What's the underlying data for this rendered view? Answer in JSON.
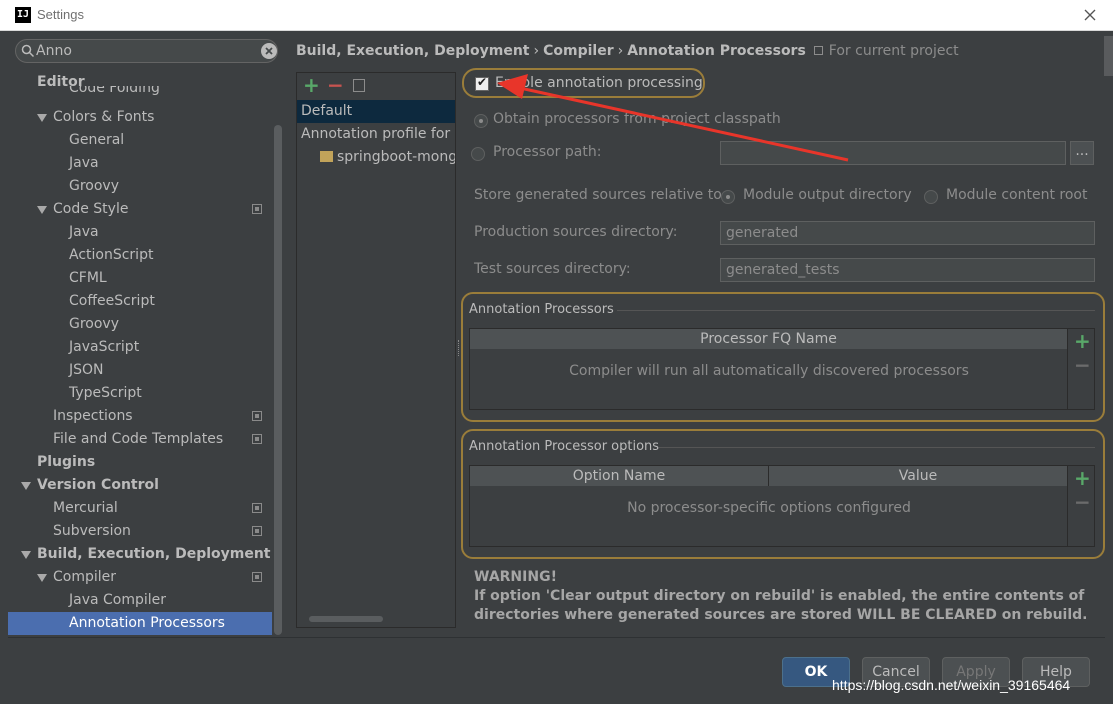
{
  "window": {
    "title": "Settings",
    "app_icon_text": "IJ"
  },
  "search": {
    "value": "Anno"
  },
  "sidebar": {
    "items": [
      {
        "label": "Editor",
        "bold": true
      },
      {
        "label": "Code Folding"
      },
      {
        "label": "Colors & Fonts",
        "expanded": true
      },
      {
        "label": "General"
      },
      {
        "label": "Java"
      },
      {
        "label": "Groovy"
      },
      {
        "label": "Code Style",
        "expanded": true
      },
      {
        "label": "Java"
      },
      {
        "label": "ActionScript"
      },
      {
        "label": "CFML"
      },
      {
        "label": "CoffeeScript"
      },
      {
        "label": "Groovy"
      },
      {
        "label": "JavaScript"
      },
      {
        "label": "JSON"
      },
      {
        "label": "TypeScript"
      },
      {
        "label": "Inspections"
      },
      {
        "label": "File and Code Templates"
      },
      {
        "label": "Plugins",
        "bold": true
      },
      {
        "label": "Version Control",
        "bold": true,
        "expanded": true
      },
      {
        "label": "Mercurial"
      },
      {
        "label": "Subversion"
      },
      {
        "label": "Build, Execution, Deployment",
        "bold": true,
        "expanded": true
      },
      {
        "label": "Compiler",
        "expanded": true
      },
      {
        "label": "Java Compiler"
      },
      {
        "label": "Annotation Processors",
        "selected": true
      }
    ]
  },
  "breadcrumb": {
    "parts": [
      "Build, Execution, Deployment",
      "Compiler",
      "Annotation Processors"
    ],
    "separator": "›",
    "scope_note": "For current project"
  },
  "profiles": {
    "items": [
      "Default",
      "Annotation profile for s",
      "springboot-mong"
    ]
  },
  "settings": {
    "enable_label": "Enable annotation processing",
    "enabled": true,
    "obtain_label": "Obtain processors from project classpath",
    "processor_path_label": "Processor path:",
    "processor_path_value": "",
    "browse_label": "...",
    "store_label": "Store generated sources relative to:",
    "module_output_label": "Module output directory",
    "module_content_label": "Module content root",
    "prod_dir_label": "Production sources directory:",
    "prod_dir_value": "generated",
    "test_dir_label": "Test sources directory:",
    "test_dir_value": "generated_tests"
  },
  "processors_group": {
    "title": "Annotation Processors",
    "column": "Processor FQ Name",
    "empty_text": "Compiler will run all automatically discovered processors"
  },
  "options_group": {
    "title": "Annotation Processor options",
    "columns": [
      "Option Name",
      "Value"
    ],
    "empty_text": "No processor-specific options configured"
  },
  "warning": {
    "title": "WARNING!",
    "text": "If option 'Clear output directory on rebuild' is enabled, the entire contents of directories where generated sources are stored WILL BE CLEARED on rebuild."
  },
  "buttons": {
    "ok": "OK",
    "cancel": "Cancel",
    "apply": "Apply",
    "help": "Help"
  },
  "watermark": "https://blog.csdn.net/weixin_39165464",
  "colors": {
    "accent": "#4b6eaf",
    "highlight": "#9a7d3a",
    "arrow": "#e8352a",
    "add": "#59a869",
    "remove": "#c75450"
  }
}
